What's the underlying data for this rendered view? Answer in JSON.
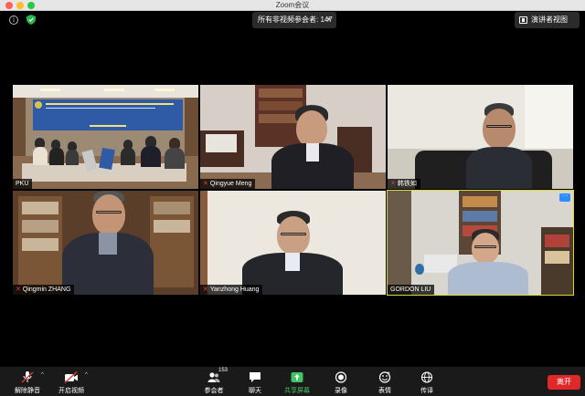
{
  "window": {
    "title": "Zoom会议"
  },
  "top": {
    "participants_dropdown": "所有非视频参会者: 147",
    "speaker_view_label": "演讲者视图"
  },
  "tiles": [
    {
      "name": "PKU",
      "muted": false
    },
    {
      "name": "Qingyue Meng",
      "muted": true
    },
    {
      "name": "韩铁如",
      "muted": true
    },
    {
      "name": "Qingmin ZHANG",
      "muted": true
    },
    {
      "name": "Yanzhong Huang",
      "muted": true
    },
    {
      "name": "GORDON LIU",
      "muted": false,
      "active": true
    }
  ],
  "toolbar": {
    "unmute_label": "解除静音",
    "start_video_label": "开启视频",
    "participants_label": "参会者",
    "participants_count": "153",
    "chat_label": "聊天",
    "share_label": "共享屏幕",
    "record_label": "录像",
    "reactions_label": "表情",
    "interpret_label": "传译",
    "leave_label": "离开"
  },
  "colors": {
    "active_speaker_outline": "#d7d836",
    "share_green": "#41c463",
    "leave_red": "#e02828",
    "muted_red": "#e23b3b"
  }
}
